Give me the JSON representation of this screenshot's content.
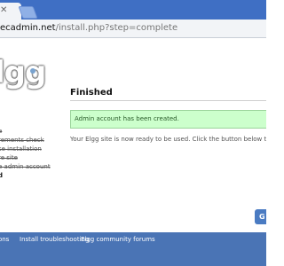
{
  "browser": {
    "tab_close_glyph": "✕",
    "url_host": "ecadmin.net",
    "url_path": "/install.php?step=complete"
  },
  "page": {
    "logo_text": "lgg",
    "steps": [
      {
        "label": "e",
        "state": "done"
      },
      {
        "label": "rements check",
        "state": "done"
      },
      {
        "label": "se installation",
        "state": "done"
      },
      {
        "label": "re site",
        "state": "done"
      },
      {
        "label": "e admin account",
        "state": "done"
      },
      {
        "label": "d",
        "state": "current"
      }
    ],
    "heading": "Finished",
    "success_message": "Admin account has been created.",
    "description": "Your Elgg site is now ready to be used. Click the button below to be taken to your",
    "go_button_label": "G"
  },
  "footer": {
    "links": [
      "ions",
      "Install troubleshooting",
      "Elgg community forums"
    ]
  },
  "colors": {
    "tabstrip": "#3f6fc4",
    "success_bg": "#ccffcc",
    "footer_bg": "#4a74b5",
    "button_bg": "#4a7bc2",
    "logo_dot": "#79a3cf"
  }
}
